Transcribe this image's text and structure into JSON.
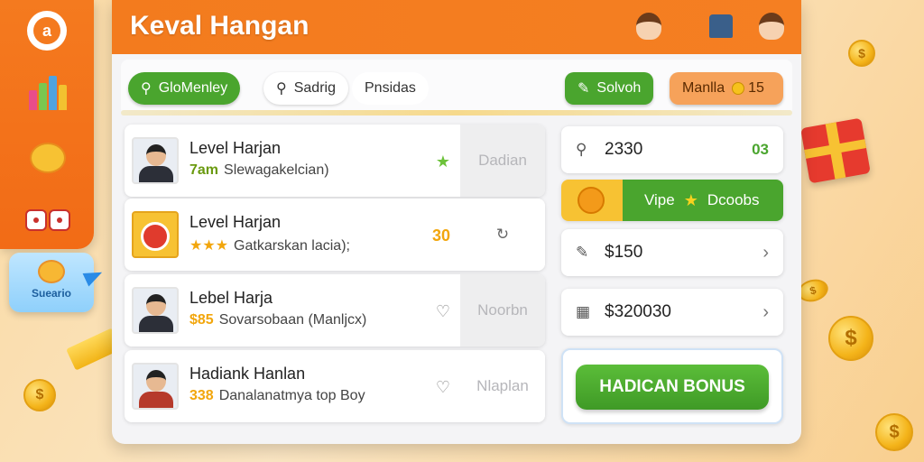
{
  "header": {
    "title": "Keval Hangan"
  },
  "sidebar": {
    "selected_label": "Sueario"
  },
  "filters": {
    "green_pill": "GloMenley",
    "search_pill": "Sadrig",
    "plain_pill": "Pnsidas",
    "solvoh_pill": "Solvoh",
    "orange_pill": "Manlla",
    "orange_pill_count": "15"
  },
  "list": {
    "rows": [
      {
        "name": "Level Harjan",
        "accent": "7am",
        "desc": "Slewagakelcian)",
        "action": "Dadian"
      },
      {
        "name": "Level Harjan",
        "accent": "★★★",
        "desc": "Gatkarskan lacia);",
        "status": "30",
        "action": ""
      },
      {
        "name": "Lebel Harja",
        "accent": "$85",
        "desc": "Sovarsobaan (Manljcx)",
        "action": "Noorbn"
      },
      {
        "name": "Hadiank Hanlan",
        "accent": "338",
        "desc": "Danalanatmya top Boy",
        "action": "Nlaplan"
      }
    ]
  },
  "right": {
    "balance_value": "2330",
    "balance_extra": "03",
    "vip_label": "Vipe",
    "vip_extra": "Dcoobs",
    "price_value": "$150",
    "amount_value": "$320030",
    "bonus_button": "HADICAN BONUS"
  },
  "colors": {
    "accent_orange": "#f37b1e",
    "accent_green": "#4aa52e",
    "coin_gold": "#f4b41a"
  }
}
